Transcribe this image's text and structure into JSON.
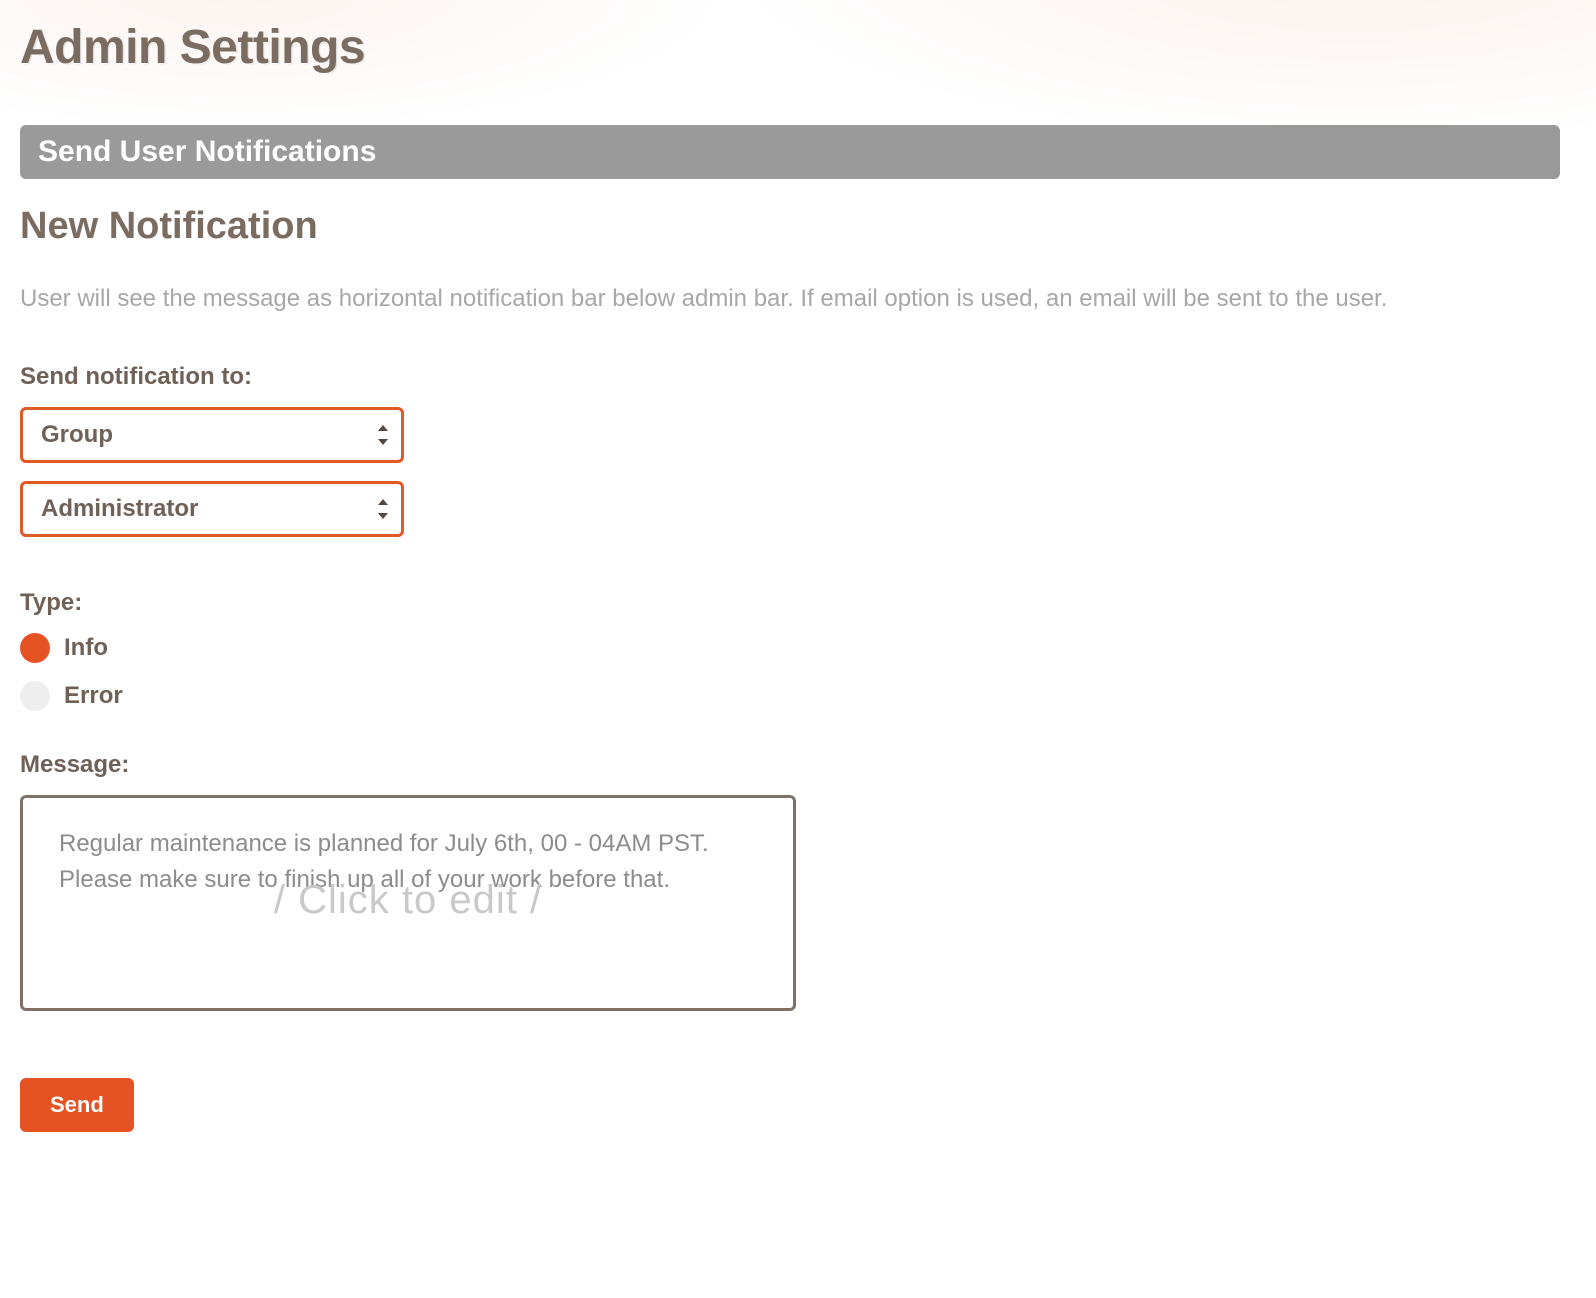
{
  "page": {
    "title": "Admin Settings"
  },
  "panel": {
    "header": "Send User Notifications"
  },
  "form": {
    "section_title": "New Notification",
    "description": "User will see the message as horizontal notification bar below admin bar. If email option is used, an email will be sent to the user.",
    "recipient": {
      "label": "Send notification to:",
      "scope_select": {
        "selected": "Group"
      },
      "target_select": {
        "selected": "Administrator"
      }
    },
    "type": {
      "label": "Type:",
      "options": [
        {
          "value": "info",
          "label": "Info",
          "checked": true
        },
        {
          "value": "error",
          "label": "Error",
          "checked": false
        }
      ]
    },
    "message": {
      "label": "Message:",
      "value": "Regular maintenance is planned for July 6th, 00 - 04AM PST. Please make sure to finish up all of your work before that.",
      "ghost_hint": "/ Click to edit /"
    },
    "submit_label": "Send"
  },
  "colors": {
    "accent": "#e55224",
    "text_muted": "#7b6c62",
    "panel_header_bg": "#9a9a9a"
  }
}
